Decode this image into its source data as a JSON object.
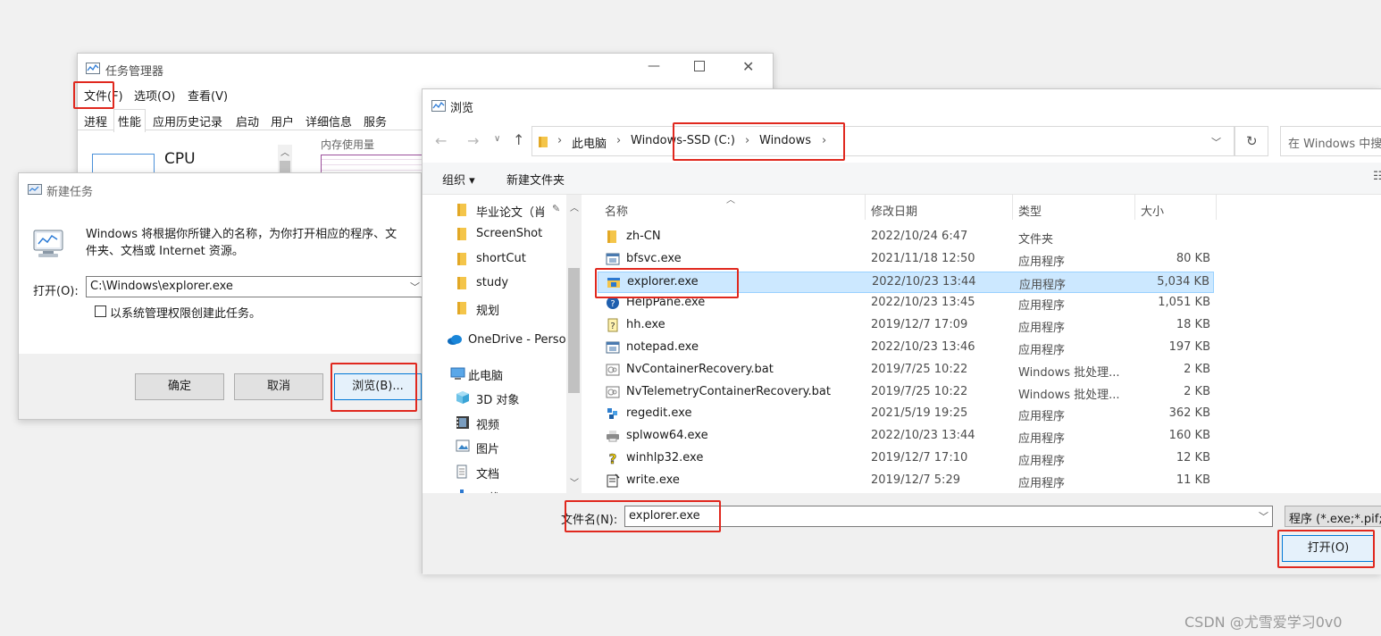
{
  "task_manager": {
    "title": "任务管理器",
    "menu": [
      "文件(F)",
      "选项(O)",
      "查看(V)"
    ],
    "tabs": [
      "进程",
      "性能",
      "应用历史记录",
      "启动",
      "用户",
      "详细信息",
      "服务"
    ],
    "cpu_label": "CPU",
    "memory_label": "内存使用量"
  },
  "new_task": {
    "title": "新建任务",
    "description": "Windows 将根据你所键入的名称，为你打开相应的程序、文件夹、文档或 Internet 资源。",
    "description_line1": "Windows 将根据你所键入的名称，为你打开相应的程序、文",
    "description_line2": "件夹、文档或 Internet 资源。",
    "open_label": "打开(O):",
    "open_value": "C:\\Windows\\explorer.exe",
    "admin_checkbox_label": "以系统管理权限创建此任务。",
    "ok_label": "确定",
    "cancel_label": "取消",
    "browse_label": "浏览(B)..."
  },
  "browse": {
    "title": "浏览",
    "breadcrumb": [
      "此电脑",
      "Windows-SSD (C:)",
      "Windows"
    ],
    "search_placeholder": "在 Windows 中搜",
    "organize_label": "组织 ▾",
    "new_folder_label": "新建文件夹",
    "nav_items": [
      {
        "label": "毕业论文（肖",
        "icon": "folder-icon"
      },
      {
        "label": "ScreenShot",
        "icon": "folder-icon"
      },
      {
        "label": "shortCut",
        "icon": "folder-icon"
      },
      {
        "label": "study",
        "icon": "folder-icon"
      },
      {
        "label": "规划",
        "icon": "folder-icon"
      },
      {
        "label": "OneDrive - Perso",
        "icon": "cloud-icon"
      },
      {
        "label": "此电脑",
        "icon": "computer-icon"
      },
      {
        "label": "3D 对象",
        "icon": "cube-icon"
      },
      {
        "label": "视频",
        "icon": "video-icon"
      },
      {
        "label": "图片",
        "icon": "picture-icon"
      },
      {
        "label": "文档",
        "icon": "document-icon"
      },
      {
        "label": "下载",
        "icon": "download-icon"
      }
    ],
    "columns": [
      "名称",
      "修改日期",
      "类型",
      "大小"
    ],
    "files": [
      {
        "name": "zh-CN",
        "date": "2022/10/24 6:47",
        "type": "文件夹",
        "size": "",
        "icon": "folder-icon"
      },
      {
        "name": "bfsvc.exe",
        "date": "2021/11/18 12:50",
        "type": "应用程序",
        "size": "80 KB",
        "icon": "app-icon"
      },
      {
        "name": "explorer.exe",
        "date": "2022/10/23 13:44",
        "type": "应用程序",
        "size": "5,034 KB",
        "icon": "explorer-icon"
      },
      {
        "name": "HelpPane.exe",
        "date": "2022/10/23 13:45",
        "type": "应用程序",
        "size": "1,051 KB",
        "icon": "help-icon"
      },
      {
        "name": "hh.exe",
        "date": "2019/12/7 17:09",
        "type": "应用程序",
        "size": "18 KB",
        "icon": "hh-icon"
      },
      {
        "name": "notepad.exe",
        "date": "2022/10/23 13:46",
        "type": "应用程序",
        "size": "197 KB",
        "icon": "app-icon"
      },
      {
        "name": "NvContainerRecovery.bat",
        "date": "2019/7/25 10:22",
        "type": "Windows 批处理...",
        "size": "2 KB",
        "icon": "batch-icon"
      },
      {
        "name": "NvTelemetryContainerRecovery.bat",
        "date": "2019/7/25 10:22",
        "type": "Windows 批处理...",
        "size": "2 KB",
        "icon": "batch-icon"
      },
      {
        "name": "regedit.exe",
        "date": "2021/5/19 19:25",
        "type": "应用程序",
        "size": "362 KB",
        "icon": "regedit-icon"
      },
      {
        "name": "splwow64.exe",
        "date": "2022/10/23 13:44",
        "type": "应用程序",
        "size": "160 KB",
        "icon": "printer-icon"
      },
      {
        "name": "winhlp32.exe",
        "date": "2019/12/7 17:10",
        "type": "应用程序",
        "size": "12 KB",
        "icon": "winhelp-icon"
      },
      {
        "name": "write.exe",
        "date": "2019/12/7 5:29",
        "type": "应用程序",
        "size": "11 KB",
        "icon": "write-icon"
      }
    ],
    "selected_index": 2,
    "filename_label": "文件名(N):",
    "filename_value": "explorer.exe",
    "filetype_value": "程序 (*.exe;*.pif;",
    "open_label": "打开(O)"
  },
  "watermark": "CSDN @尤雪爱学习0v0",
  "colors": {
    "highlight_red": "#e0281e",
    "selection": "#cce8ff",
    "folder": "#f4c54a"
  }
}
